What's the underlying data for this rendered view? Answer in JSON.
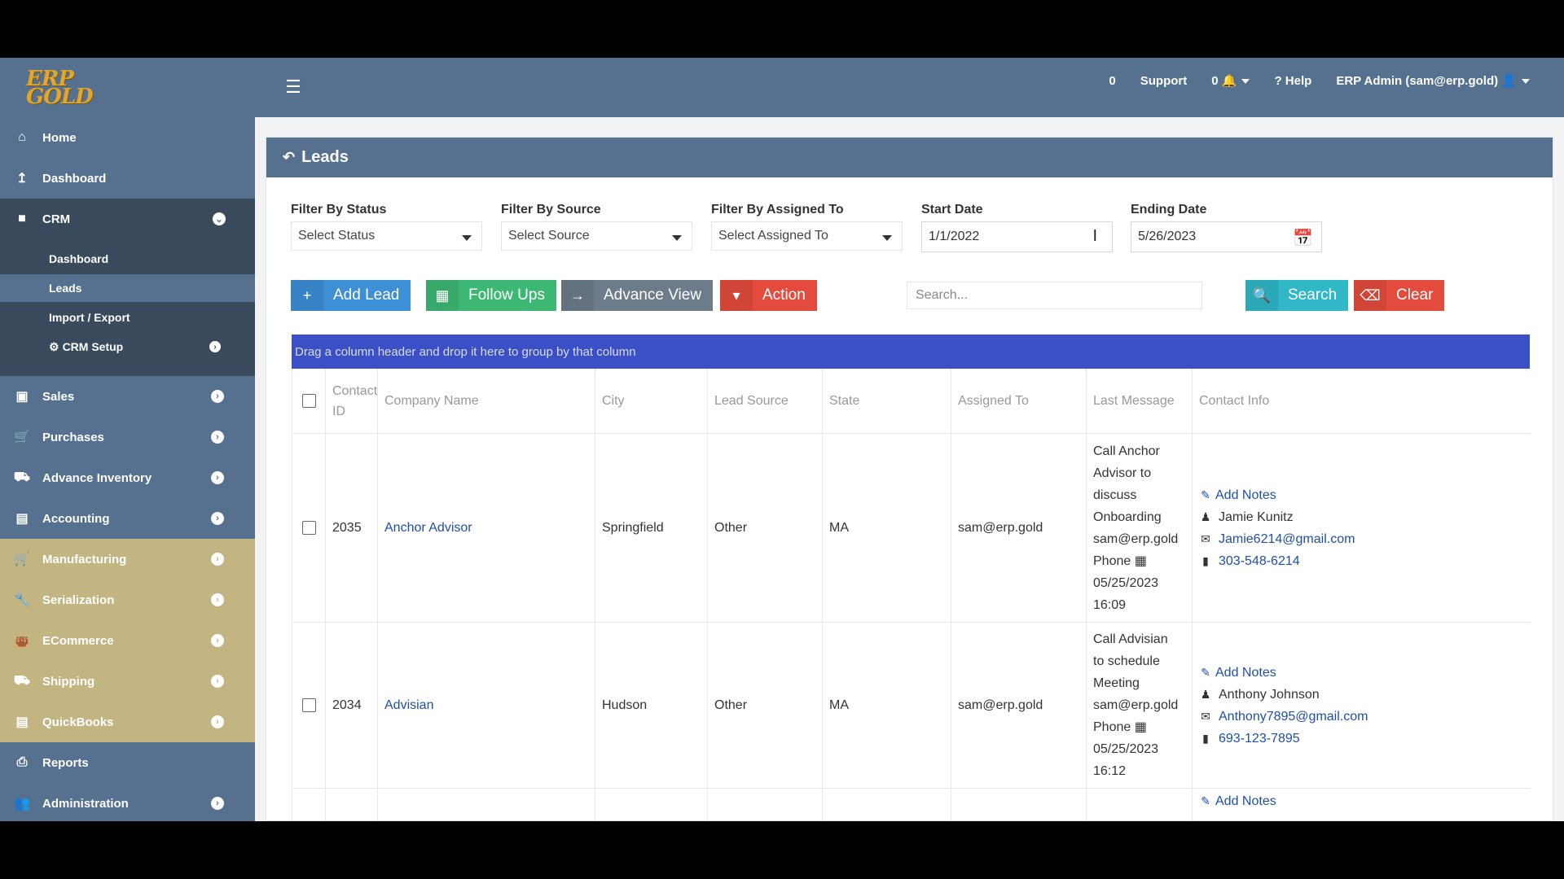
{
  "brand": {
    "logo_text": "ERP GOLD"
  },
  "topbar": {
    "menu_icon": "hamburger-icon",
    "count": "0",
    "support": "Support",
    "notif_count": "0",
    "help": "Help",
    "user": "ERP Admin (sam@erp.gold)"
  },
  "sidebar": {
    "items": [
      {
        "label": "Home",
        "icon": "home-icon"
      },
      {
        "label": "Dashboard",
        "icon": "chart-icon"
      },
      {
        "label": "CRM",
        "icon": "folder-icon"
      },
      {
        "label": "Sales",
        "icon": "money-icon"
      },
      {
        "label": "Purchases",
        "icon": "cart-icon"
      },
      {
        "label": "Advance Inventory",
        "icon": "truck-icon"
      },
      {
        "label": "Accounting",
        "icon": "book-icon"
      },
      {
        "label": "Manufacturing",
        "icon": "cart-icon"
      },
      {
        "label": "Serialization",
        "icon": "wrench-icon"
      },
      {
        "label": "ECommerce",
        "icon": "bag-icon"
      },
      {
        "label": "Shipping",
        "icon": "truck-icon"
      },
      {
        "label": "QuickBooks",
        "icon": "book-icon"
      },
      {
        "label": "Reports",
        "icon": "print-icon"
      },
      {
        "label": "Administration",
        "icon": "users-icon"
      }
    ],
    "crm_sub": [
      {
        "label": "Dashboard"
      },
      {
        "label": "Leads"
      },
      {
        "label": "Import / Export"
      },
      {
        "label": "CRM Setup"
      }
    ]
  },
  "page": {
    "title": "Leads",
    "filters": {
      "status_label": "Filter By Status",
      "status_value": "Select Status",
      "source_label": "Filter By Source",
      "source_value": "Select Source",
      "assigned_label": "Filter By Assigned To",
      "assigned_value": "Select Assigned To",
      "start_label": "Start Date",
      "start_value": "1/1/2022",
      "end_label": "Ending Date",
      "end_value": "5/26/2023"
    },
    "buttons": {
      "add_lead": "Add Lead",
      "follow_ups": "Follow Ups",
      "advance_view": "Advance View",
      "action": "Action",
      "search": "Search",
      "clear": "Clear"
    },
    "search_placeholder": "Search...",
    "group_hint": "Drag a column header and drop it here to group by that column",
    "columns": [
      "Contact ID",
      "Company Name",
      "City",
      "Lead Source",
      "State",
      "Assigned To",
      "Last Message",
      "Contact Info"
    ],
    "rows": [
      {
        "id": "2035",
        "company": "Anchor Advisor",
        "city": "Springfield",
        "source": "Other",
        "state": "MA",
        "assigned": "sam@erp.gold",
        "message": [
          "Call Anchor",
          "Advisor to",
          "discuss",
          "Onboarding",
          "sam@erp.gold",
          "Phone",
          "05/25/2023",
          "16:09"
        ],
        "notes": "Add Notes",
        "contact": "Jamie Kunitz",
        "email": "Jamie6214@gmail.com",
        "phone": "303-548-6214"
      },
      {
        "id": "2034",
        "company": "Advisian",
        "city": "Hudson",
        "source": "Other",
        "state": "MA",
        "assigned": "sam@erp.gold",
        "message": [
          "Call Advisian",
          "to schedule",
          "Meeting",
          "sam@erp.gold",
          "Phone",
          "05/25/2023",
          "16:12"
        ],
        "notes": "Add Notes",
        "contact": "Anthony Johnson",
        "email": "Anthony7895@gmail.com",
        "phone": "693-123-7895"
      },
      {
        "notes": "Add Notes"
      }
    ]
  }
}
